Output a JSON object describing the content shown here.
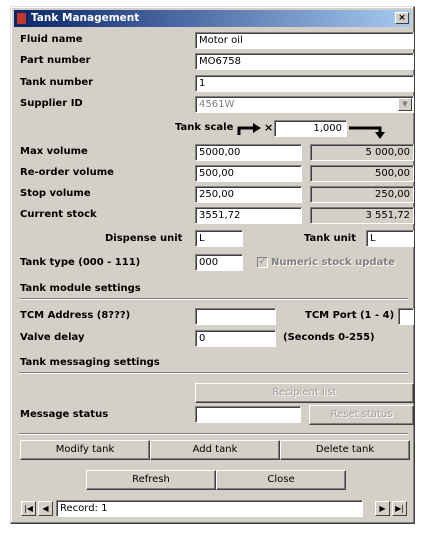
{
  "window": {
    "title": "Tank Management",
    "close_glyph": "×"
  },
  "fields": {
    "fluid_name": {
      "label": "Fluid name",
      "value": "Motor oil"
    },
    "part_number": {
      "label": "Part number",
      "value": "MO6758"
    },
    "tank_number": {
      "label": "Tank number",
      "value": "1"
    },
    "supplier_id": {
      "label": "Supplier ID",
      "value": "4561W"
    }
  },
  "tank_scale": {
    "label": "Tank scale",
    "multiplier": "×",
    "value": "1,000"
  },
  "volumes": {
    "max": {
      "label": "Max volume",
      "value": "5000,00",
      "scaled": "5 000,00"
    },
    "reorder": {
      "label": "Re-order volume",
      "value": "500,00",
      "scaled": "500,00"
    },
    "stop": {
      "label": "Stop volume",
      "value": "250,00",
      "scaled": "250,00"
    },
    "current": {
      "label": "Current stock",
      "value": "3551,72",
      "scaled": "3 551,72"
    }
  },
  "units": {
    "dispense_label": "Dispense unit",
    "dispense_value": "L",
    "tank_label": "Tank unit",
    "tank_value": "L"
  },
  "tank_type": {
    "label": "Tank type (000 - 111)",
    "value": "000",
    "numeric_label": "Numeric stock update",
    "numeric_checked": true
  },
  "tank_module": {
    "header": "Tank module settings",
    "tcm_address_label": "TCM Address (8???)",
    "tcm_address_value": "",
    "tcm_port_label": "TCM Port (1 - 4)",
    "tcm_port_value": "",
    "valve_delay_label": "Valve delay",
    "valve_delay_value": "0",
    "valve_delay_hint": "(Seconds 0-255)"
  },
  "messaging": {
    "header": "Tank messaging settings",
    "recipient_button": "Recipient list",
    "message_status_label": "Message status",
    "message_status_value": "",
    "reset_button": "Reset status"
  },
  "actions": {
    "modify": "Modify tank",
    "add": "Add tank",
    "delete": "Delete tank",
    "refresh": "Refresh",
    "close": "Close"
  },
  "navigator": {
    "record_text": "Record: 1",
    "first": "|◀",
    "prev": "◀",
    "next": "▶",
    "last": "▶|"
  },
  "colors": {
    "titlebar_start": "#0a246a",
    "titlebar_end": "#a6caf0",
    "face": "#d4d0c8"
  }
}
